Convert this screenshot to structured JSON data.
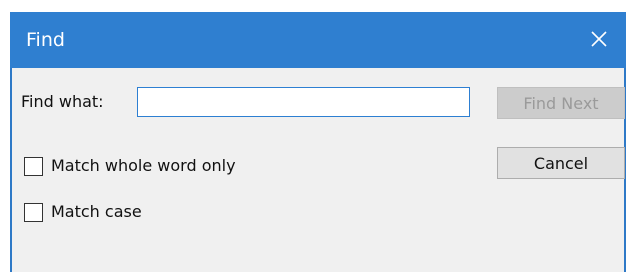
{
  "window": {
    "title": "Find",
    "close_icon": "close-icon",
    "colors": {
      "titlebar": "#2f7fd0",
      "client": "#f0f0f0",
      "input_border": "#2d7fd2"
    }
  },
  "find": {
    "label": "Find what:",
    "value": "",
    "placeholder": ""
  },
  "options": {
    "match_whole_word": {
      "label": "Match whole word only",
      "checked": false
    },
    "match_case": {
      "label": "Match case",
      "checked": false
    }
  },
  "buttons": {
    "find_next": {
      "label": "Find Next",
      "enabled": false
    },
    "cancel": {
      "label": "Cancel",
      "enabled": true
    }
  }
}
